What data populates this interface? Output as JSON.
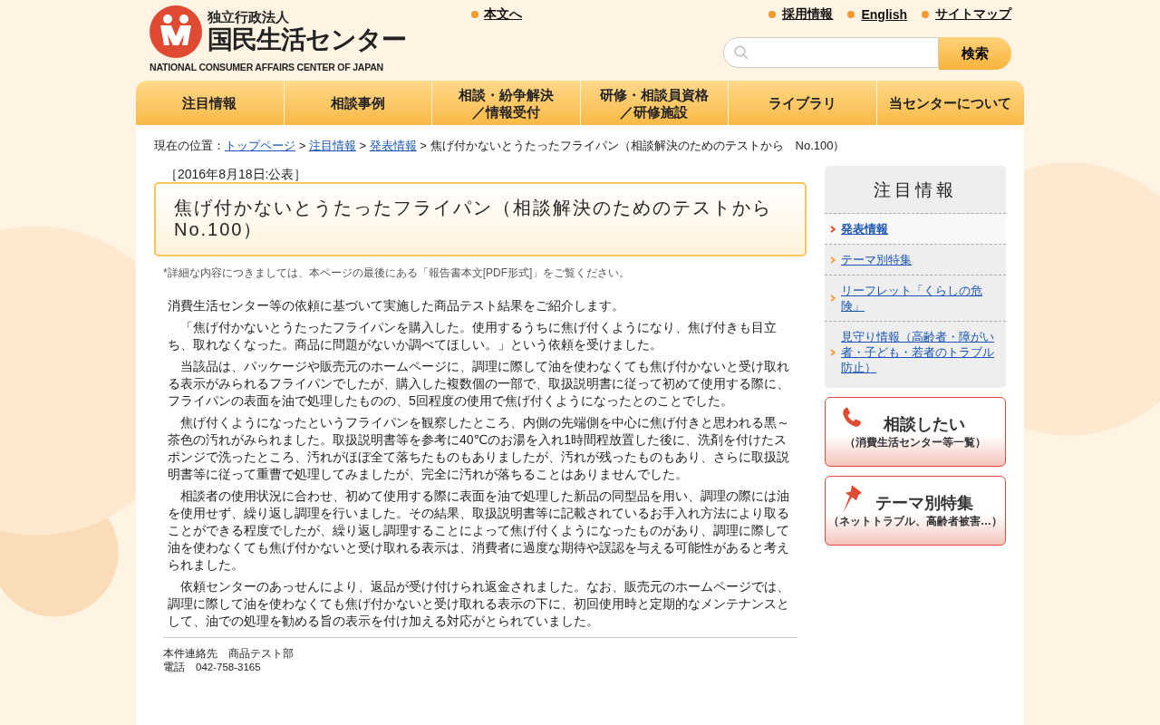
{
  "header": {
    "logo": {
      "org_type": "独立行政法人",
      "name": "国民生活センター",
      "english": "NATIONAL CONSUMER AFFAIRS CENTER OF JAPAN"
    },
    "skip_link": "本文へ",
    "utility_links": [
      "採用情報",
      "English",
      "サイトマップ"
    ],
    "search": {
      "button": "検索"
    }
  },
  "nav": [
    [
      "注目情報"
    ],
    [
      "相談事例"
    ],
    [
      "相談・紛争解決",
      "／情報受付"
    ],
    [
      "研修・相談員資格",
      "／研修施設"
    ],
    [
      "ライブラリ"
    ],
    [
      "当センターについて"
    ]
  ],
  "breadcrumb": {
    "label": "現在の位置：",
    "separator": ">",
    "links": [
      "トップページ",
      "注目情報",
      "発表情報"
    ],
    "current": "焦げ付かないとうたったフライパン（相談解決のためのテストから　No.100）"
  },
  "article": {
    "date": "［2016年8月18日:公表］",
    "title": "焦げ付かないとうたったフライパン（相談解決のためのテストから No.100）",
    "note": "*詳細な内容につきましては、本ページの最後にある「報告書本文[PDF形式]」をご覧ください。",
    "paragraphs": [
      "消費生活センター等の依頼に基づいて実施した商品テスト結果をご紹介します。",
      "「焦げ付かないとうたったフライパンを購入した。使用するうちに焦げ付くようになり、焦げ付きも目立ち、取れなくなった。商品に問題がないか調べてほしい。」という依頼を受けました。",
      "当該品は、パッケージや販売元のホームページに、調理に際して油を使わなくても焦げ付かないと受け取れる表示がみられるフライパンでしたが、購入した複数個の一部で、取扱説明書に従って初めて使用する際に、フライパンの表面を油で処理したものの、5回程度の使用で焦げ付くようになったとのことでした。",
      "焦げ付くようになったというフライパンを観察したところ、内側の先端側を中心に焦げ付きと思われる黒～茶色の汚れがみられました。取扱説明書等を参考に40℃のお湯を入れ1時間程放置した後に、洗剤を付けたスポンジで洗ったところ、汚れがほぼ全て落ちたものもありましたが、汚れが残ったものもあり、さらに取扱説明書等に従って重曹で処理してみましたが、完全に汚れが落ちることはありませんでした。",
      "相談者の使用状況に合わせ、初めて使用する際に表面を油で処理した新品の同型品を用い、調理の際には油を使用せず、繰り返し調理を行いました。その結果、取扱説明書等に記載されているお手入れ方法により取ることができる程度でしたが、繰り返し調理することによって焦げ付くようになったものがあり、調理に際して油を使わなくても焦げ付かないと受け取れる表示は、消費者に過度な期待や誤認を与える可能性があると考えられました。",
      "依頼センターのあっせんにより、返品が受け付けられ返金されました。なお、販売元のホームページでは、調理に際して油を使わなくても焦げ付かないと受け取れる表示の下に、初回使用時と定期的なメンテナンスとして、油での処理を勧める旨の表示を付け加える対応がとられていました。"
    ],
    "contact": [
      "本件連絡先　商品テスト部",
      "電話　042-758-3165"
    ]
  },
  "sidebar": {
    "title": "注目情報",
    "items": [
      {
        "label": "発表情報",
        "selected": true
      },
      {
        "label": "テーマ別特集",
        "selected": false
      },
      {
        "label": "リーフレット「くらしの危険」",
        "selected": false
      },
      {
        "label": "見守り情報（高齢者・障がい者・子ども・若者のトラブル防止）",
        "selected": false
      }
    ],
    "banners": [
      {
        "kind": "phone",
        "title": "相談したい",
        "subtitle": "（消費生活センター等一覧）"
      },
      {
        "kind": "pin",
        "title": "テーマ別特集",
        "subtitle": "（ネットトラブル、高齢者被害…）"
      }
    ]
  }
}
